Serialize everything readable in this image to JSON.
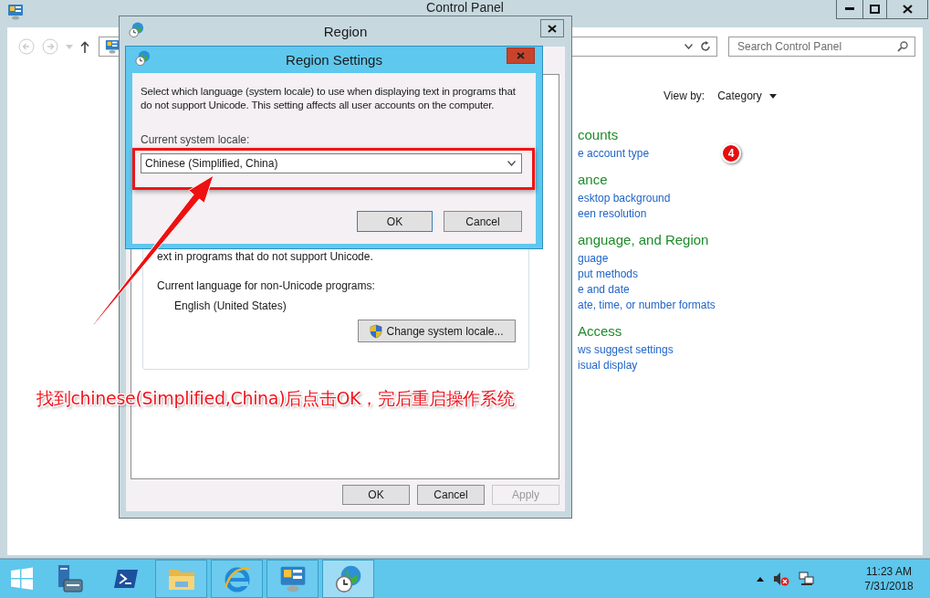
{
  "control_panel": {
    "title": "Control Panel",
    "search": {
      "placeholder": "Search Control Panel"
    },
    "view_by": {
      "label": "View by:",
      "value": "Category"
    },
    "categories": [
      {
        "heading": "counts",
        "links": [
          "e account type"
        ]
      },
      {
        "heading": "ance",
        "links": [
          "esktop background",
          "een resolution"
        ]
      },
      {
        "heading": "anguage, and Region",
        "links": [
          "guage",
          "put methods",
          "e and date",
          "ate, time, or number formats"
        ]
      },
      {
        "heading": "Access",
        "links": [
          "ws suggest settings",
          "isual display"
        ]
      }
    ]
  },
  "region_dialog": {
    "title": "Region",
    "intro_fragment": "ext in programs that do not support Unicode.",
    "current_language_label": "Current language for non-Unicode programs:",
    "current_language": "English (United States)",
    "change_locale_button": "Change system locale...",
    "buttons": [
      {
        "label": "OK",
        "disabled": false
      },
      {
        "label": "Cancel",
        "disabled": false
      },
      {
        "label": "Apply",
        "disabled": true
      }
    ]
  },
  "region_settings_dialog": {
    "title": "Region Settings",
    "description": "Select which language (system locale) to use when displaying text in programs that do not support Unicode. This setting affects all user accounts on the computer.",
    "locale_label": "Current system locale:",
    "locale_value": "Chinese (Simplified, China)",
    "buttons": [
      {
        "label": "OK",
        "default": true
      },
      {
        "label": "Cancel",
        "default": false
      }
    ]
  },
  "annotation": {
    "caption": "找到chinese(Simplified,China)后点击OK，完后重启操作系统",
    "step_badge": "4"
  },
  "taskbar": {
    "apps": [
      {
        "kind": "server-manager",
        "running": false,
        "selected": false
      },
      {
        "kind": "powershell",
        "running": false,
        "selected": false
      },
      {
        "kind": "file-explorer",
        "running": true,
        "selected": false
      },
      {
        "kind": "browser",
        "running": true,
        "selected": false
      },
      {
        "kind": "control-panel",
        "running": true,
        "selected": false
      },
      {
        "kind": "region",
        "running": true,
        "selected": true
      }
    ],
    "time": "11:23 AM",
    "date": "7/31/2018"
  }
}
